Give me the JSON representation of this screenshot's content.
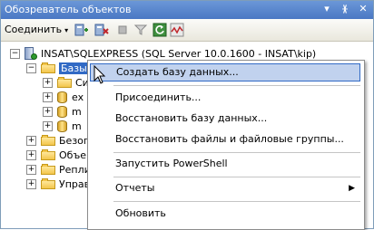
{
  "window": {
    "title": "Обозреватель объектов",
    "icons": [
      "▾",
      "ᚕ",
      "✕"
    ]
  },
  "toolbar": {
    "connect_label": "Соединить",
    "connect_arrow": "▾"
  },
  "tree": {
    "expander_minus": "−",
    "expander_plus": "+",
    "server_label": "INSAT\\SQLEXPRESS (SQL Server 10.0.1600 - INSAT\\kip)",
    "databases_label": "Базы",
    "child_items": [
      "Си",
      "ex",
      "m",
      "m"
    ],
    "top_items": [
      "Безоп",
      "Объе",
      "Репли",
      "Управ"
    ]
  },
  "context_menu": {
    "items": [
      {
        "label": "Создать базу данных..."
      },
      {
        "label": "Присоединить..."
      },
      {
        "label": "Восстановить базу данных..."
      },
      {
        "label": "Восстановить файлы и файловые группы..."
      },
      {
        "label": "Запустить PowerShell"
      },
      {
        "label": "Отчеты"
      },
      {
        "label": "Обновить"
      }
    ],
    "submenu_arrow": "▶",
    "highlight_color": "#c1d2ee",
    "accent": "#316ac5"
  }
}
